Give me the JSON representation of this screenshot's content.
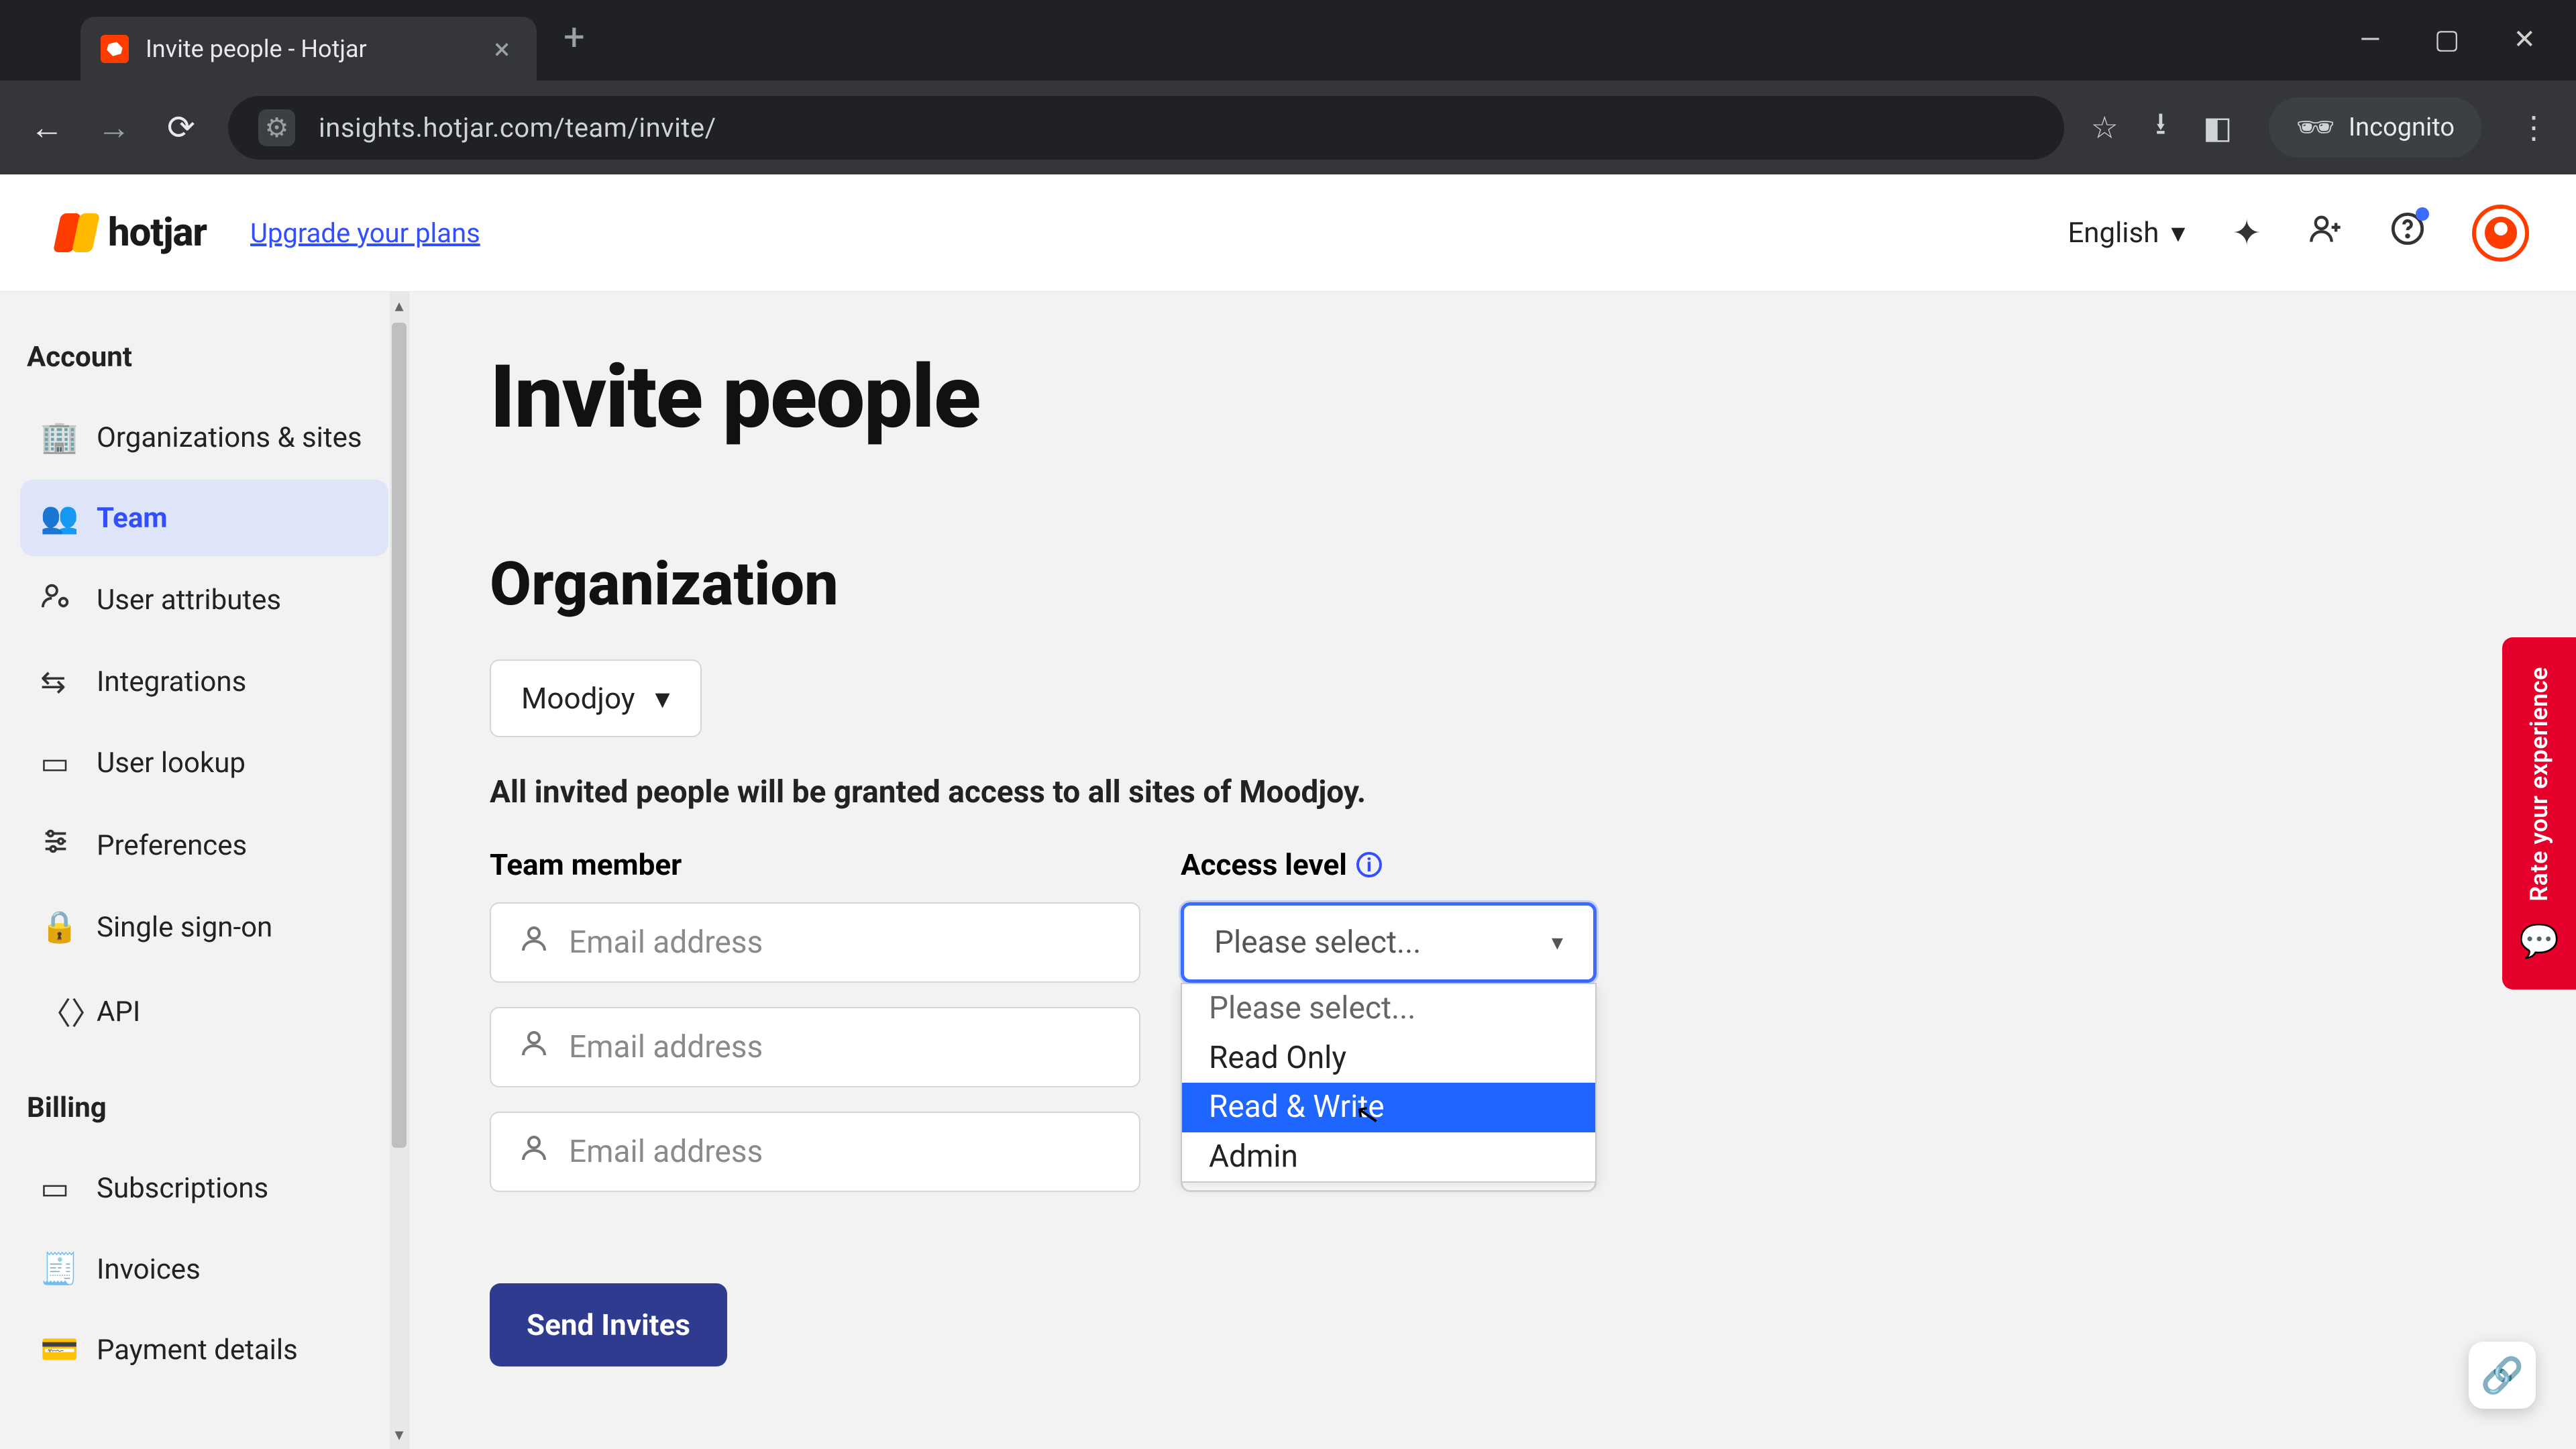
{
  "browser": {
    "tab_title": "Invite people - Hotjar",
    "url": "insights.hotjar.com/team/invite/",
    "incognito_label": "Incognito"
  },
  "header": {
    "brand": "hotjar",
    "upgrade": "Upgrade your plans",
    "language": "English"
  },
  "sidebar": {
    "section_account": "Account",
    "section_billing": "Billing",
    "items_account": [
      {
        "label": "Organizations & sites"
      },
      {
        "label": "Team"
      },
      {
        "label": "User attributes"
      },
      {
        "label": "Integrations"
      },
      {
        "label": "User lookup"
      },
      {
        "label": "Preferences"
      },
      {
        "label": "Single sign-on"
      },
      {
        "label": "API"
      }
    ],
    "items_billing": [
      {
        "label": "Subscriptions"
      },
      {
        "label": "Invoices"
      },
      {
        "label": "Payment details"
      }
    ]
  },
  "page": {
    "title": "Invite people",
    "section": "Organization",
    "org_selected": "Moodjoy",
    "grant_note": "All invited people will be granted access to all sites of Moodjoy.",
    "col_team": "Team member",
    "col_access": "Access level",
    "email_placeholder": "Email address",
    "access_placeholder": "Please select...",
    "access_options": [
      "Please select...",
      "Read Only",
      "Read & Write",
      "Admin"
    ],
    "send_label": "Send Invites"
  },
  "feedback": {
    "label": "Rate your experience"
  }
}
